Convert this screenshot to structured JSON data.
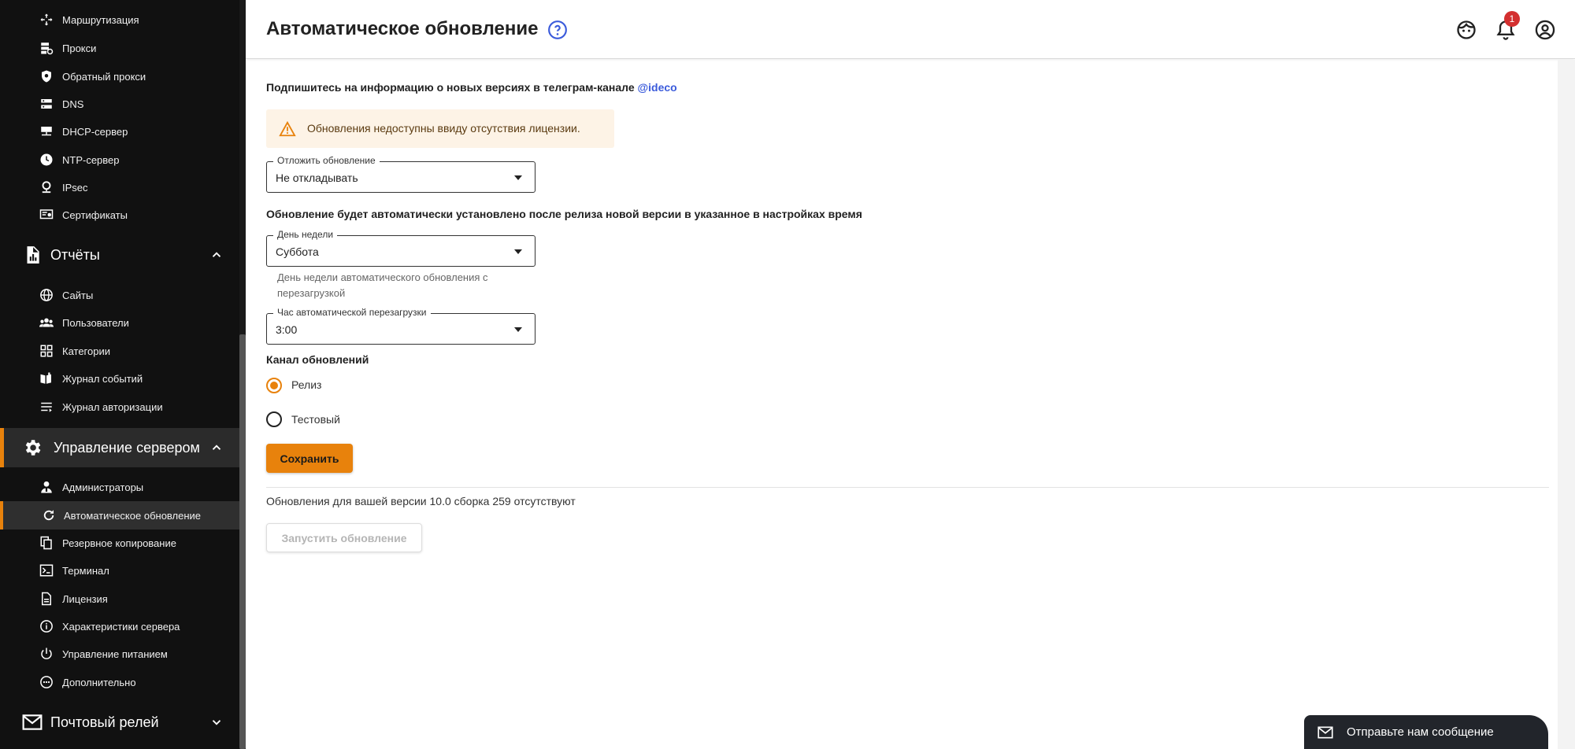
{
  "sidebar": {
    "network_items": [
      {
        "label": "Маршрутизация",
        "icon": "routing-icon"
      },
      {
        "label": "Прокси",
        "icon": "proxy-icon"
      },
      {
        "label": "Обратный прокси",
        "icon": "reverse-proxy-icon"
      },
      {
        "label": "DNS",
        "icon": "dns-icon"
      },
      {
        "label": "DHCP-сервер",
        "icon": "dhcp-icon"
      },
      {
        "label": "NTP-сервер",
        "icon": "clock-icon"
      },
      {
        "label": "IPsec",
        "icon": "ipsec-icon"
      },
      {
        "label": "Сертификаты",
        "icon": "certificate-icon"
      }
    ],
    "reports_section": {
      "label": "Отчёты",
      "icon": "report-icon"
    },
    "reports_items": [
      {
        "label": "Сайты",
        "icon": "globe-icon"
      },
      {
        "label": "Пользователи",
        "icon": "users-icon"
      },
      {
        "label": "Категории",
        "icon": "categories-icon"
      },
      {
        "label": "Журнал событий",
        "icon": "event-log-icon"
      },
      {
        "label": "Журнал авторизации",
        "icon": "auth-log-icon"
      }
    ],
    "server_section": {
      "label": "Управление сервером",
      "icon": "gear-icon"
    },
    "server_items": [
      {
        "label": "Администраторы",
        "icon": "admin-icon"
      },
      {
        "label": "Автоматическое обновление",
        "icon": "refresh-icon",
        "active": true
      },
      {
        "label": "Резервное копирование",
        "icon": "backup-icon"
      },
      {
        "label": "Терминал",
        "icon": "terminal-icon"
      },
      {
        "label": "Лицензия",
        "icon": "license-icon"
      },
      {
        "label": "Характеристики сервера",
        "icon": "info-icon"
      },
      {
        "label": "Управление питанием",
        "icon": "power-icon"
      },
      {
        "label": "Дополнительно",
        "icon": "more-icon"
      }
    ],
    "mail_section": {
      "label": "Почтовый релей",
      "icon": "mail-icon"
    }
  },
  "header": {
    "title": "Автоматическое обновление",
    "notification_count": "1"
  },
  "main": {
    "subscribe_text": "Подпишитесь на информацию о новых версиях в телеграм-канале ",
    "subscribe_link": "@ideco",
    "alert_text": "Обновления недоступны ввиду отсутствия лицензии.",
    "postpone": {
      "label": "Отложить обновление",
      "value": "Не откладывать"
    },
    "auto_note": "Обновление будет автоматически установлено после релиза новой версии в указанное в настройках время",
    "weekday": {
      "label": "День недели",
      "value": "Суббота",
      "helper": "День недели автоматического обновления с перезагрузкой"
    },
    "reboot_hour": {
      "label": "Час автоматической перезагрузки",
      "value": "3:00"
    },
    "channel_title": "Канал обновлений",
    "channel_options": [
      {
        "label": "Релиз",
        "selected": true
      },
      {
        "label": "Тестовый",
        "selected": false
      }
    ],
    "save_label": "Сохранить",
    "version_text": "Обновления для вашей версии 10.0 сборка 259 отсутствуют",
    "run_update_label": "Запустить обновление"
  },
  "chat": {
    "label": "Отправьте нам сообщение"
  },
  "colors": {
    "accent": "#e8820c",
    "sidebar": "#111111",
    "link": "#3b5bdb",
    "alert_bg": "#fdf3e6",
    "badge": "#d32f2f"
  }
}
